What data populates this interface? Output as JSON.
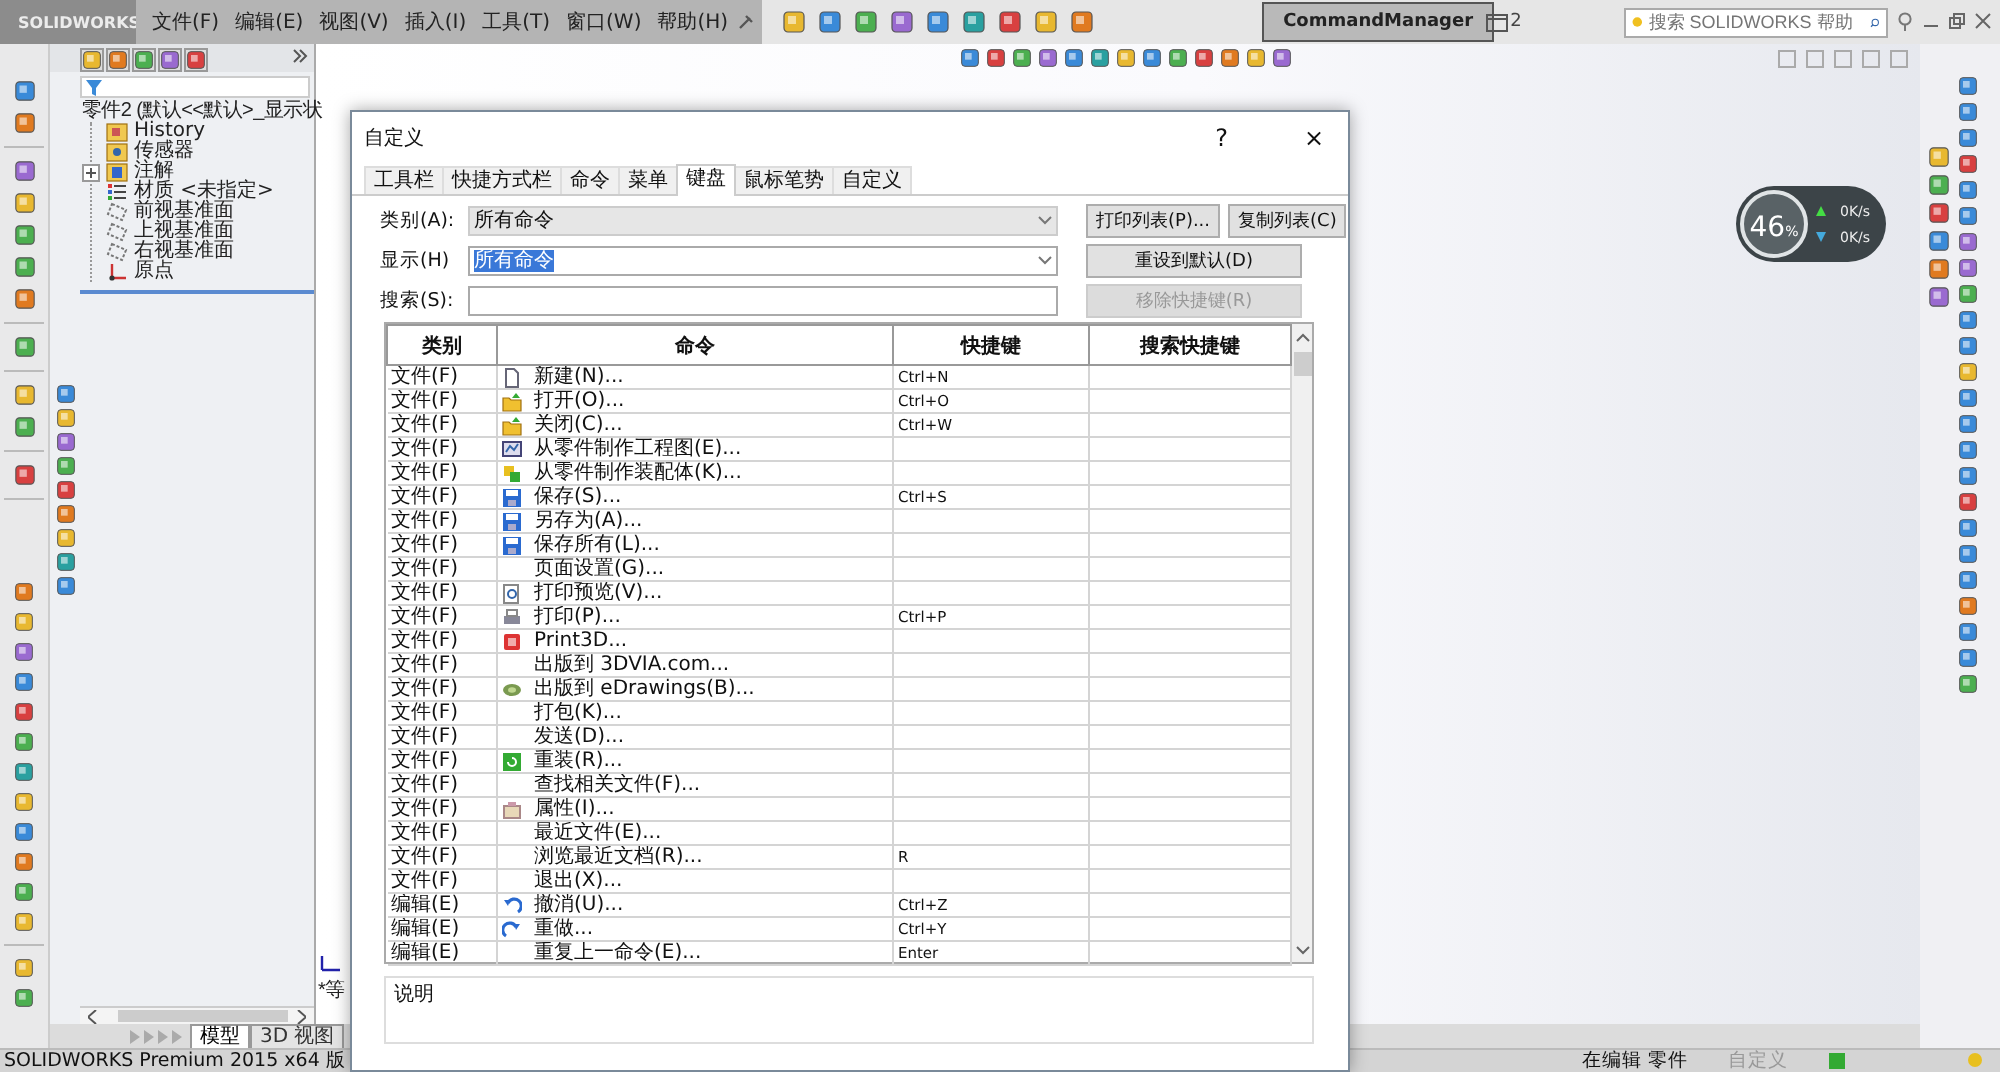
{
  "menubar": {
    "logo": "SOLIDWORKS",
    "menus": [
      "文件(F)",
      "编辑(E)",
      "视图(V)",
      "插入(I)",
      "工具(T)",
      "窗口(W)",
      "帮助(H)"
    ],
    "command_manager": "CommandManager",
    "title_fragment": "2",
    "search": {
      "placeholder": "搜索 SOLIDWORKS 帮助"
    }
  },
  "feature_tree": {
    "root": "零件2 (默认<<默认>_显示状",
    "children": [
      {
        "label": "History",
        "kind": "history"
      },
      {
        "label": "传感器",
        "kind": "sensor"
      },
      {
        "label": "注解",
        "kind": "annotation",
        "expanded": false
      },
      {
        "label": "材质 <未指定>",
        "kind": "material"
      },
      {
        "label": "前视基准面",
        "kind": "plane"
      },
      {
        "label": "上视基准面",
        "kind": "plane"
      },
      {
        "label": "右视基准面",
        "kind": "plane"
      },
      {
        "label": "原点",
        "kind": "origin"
      }
    ]
  },
  "view_label": "*等",
  "bottom_tabs": [
    {
      "label": "模型",
      "selected": true
    },
    {
      "label": "3D 视图",
      "selected": false
    }
  ],
  "monitor": {
    "percent": "46",
    "unit": "%",
    "upload": "0K/s",
    "download": "0K/s"
  },
  "dialog": {
    "title": "自定义",
    "help": "?",
    "close": "×",
    "tabs": [
      {
        "label": "工具栏",
        "selected": false
      },
      {
        "label": "快捷方式栏",
        "selected": false
      },
      {
        "label": "命令",
        "selected": false
      },
      {
        "label": "菜单",
        "selected": false
      },
      {
        "label": "键盘",
        "selected": true
      },
      {
        "label": "鼠标笔势",
        "selected": false
      },
      {
        "label": "自定义",
        "selected": false
      }
    ],
    "category": {
      "label": "类别(A):",
      "value": "所有命令"
    },
    "show": {
      "label": "显示(H)",
      "value": "所有命令",
      "highlighted": true
    },
    "search": {
      "label": "搜索(S):"
    },
    "buttons": [
      {
        "label": "打印列表(P)...",
        "disabled": false
      },
      {
        "label": "复制列表(C)",
        "disabled": false
      },
      {
        "label": "重设到默认(D)",
        "disabled": false
      },
      {
        "label": "移除快捷键(R)",
        "disabled": true
      }
    ],
    "table": {
      "columns": [
        "类别",
        "命令",
        "快捷键",
        "搜索快捷键"
      ],
      "rows": [
        {
          "category": "文件(F)",
          "command": "新建(N)...",
          "kind": "new",
          "shortcut": "Ctrl+N"
        },
        {
          "category": "文件(F)",
          "command": "打开(O)...",
          "kind": "open",
          "shortcut": "Ctrl+O"
        },
        {
          "category": "文件(F)",
          "command": "关闭(C)...",
          "kind": "open",
          "shortcut": "Ctrl+W"
        },
        {
          "category": "文件(F)",
          "command": "从零件制作工程图(E)...",
          "kind": "drawing"
        },
        {
          "category": "文件(F)",
          "command": "从零件制作装配体(K)...",
          "kind": "assembly"
        },
        {
          "category": "文件(F)",
          "command": "保存(S)...",
          "kind": "save",
          "shortcut": "Ctrl+S"
        },
        {
          "category": "文件(F)",
          "command": "另存为(A)...",
          "kind": "saveas"
        },
        {
          "category": "文件(F)",
          "command": "保存所有(L)...",
          "kind": "saveall"
        },
        {
          "category": "文件(F)",
          "command": "页面设置(G)...",
          "kind": "none"
        },
        {
          "category": "文件(F)",
          "command": "打印预览(V)...",
          "kind": "preview"
        },
        {
          "category": "文件(F)",
          "command": "打印(P)...",
          "kind": "print",
          "shortcut": "Ctrl+P"
        },
        {
          "category": "文件(F)",
          "command": "Print3D...",
          "kind": "print3d"
        },
        {
          "category": "文件(F)",
          "command": "出版到 3DVIA.com...",
          "kind": "none"
        },
        {
          "category": "文件(F)",
          "command": "出版到 eDrawings(B)...",
          "kind": "publish"
        },
        {
          "category": "文件(F)",
          "command": "打包(K)...",
          "kind": "none"
        },
        {
          "category": "文件(F)",
          "command": "发送(D)...",
          "kind": "none"
        },
        {
          "category": "文件(F)",
          "command": "重装(R)...",
          "kind": "reload"
        },
        {
          "category": "文件(F)",
          "command": "查找相关文件(F)...",
          "kind": "none"
        },
        {
          "category": "文件(F)",
          "command": "属性(I)...",
          "kind": "properties"
        },
        {
          "category": "文件(F)",
          "command": "最近文件(E)...",
          "kind": "none"
        },
        {
          "category": "文件(F)",
          "command": "浏览最近文档(R)...",
          "kind": "none",
          "shortcut": "R"
        },
        {
          "category": "文件(F)",
          "command": "退出(X)...",
          "kind": "none"
        },
        {
          "category": "编辑(E)",
          "command": "撤消(U)...",
          "kind": "undo",
          "shortcut": "Ctrl+Z"
        },
        {
          "category": "编辑(E)",
          "command": "重做...",
          "kind": "redo",
          "shortcut": "Ctrl+Y"
        },
        {
          "category": "编辑(E)",
          "command": "重复上一命令(E)...",
          "kind": "none",
          "shortcut": "Enter"
        }
      ]
    },
    "description": {
      "label": "说明"
    }
  },
  "status_bar": {
    "product": "SOLIDWORKS Premium 2015 x64 版",
    "mode": "在编辑 零件",
    "custom": "自定义"
  }
}
